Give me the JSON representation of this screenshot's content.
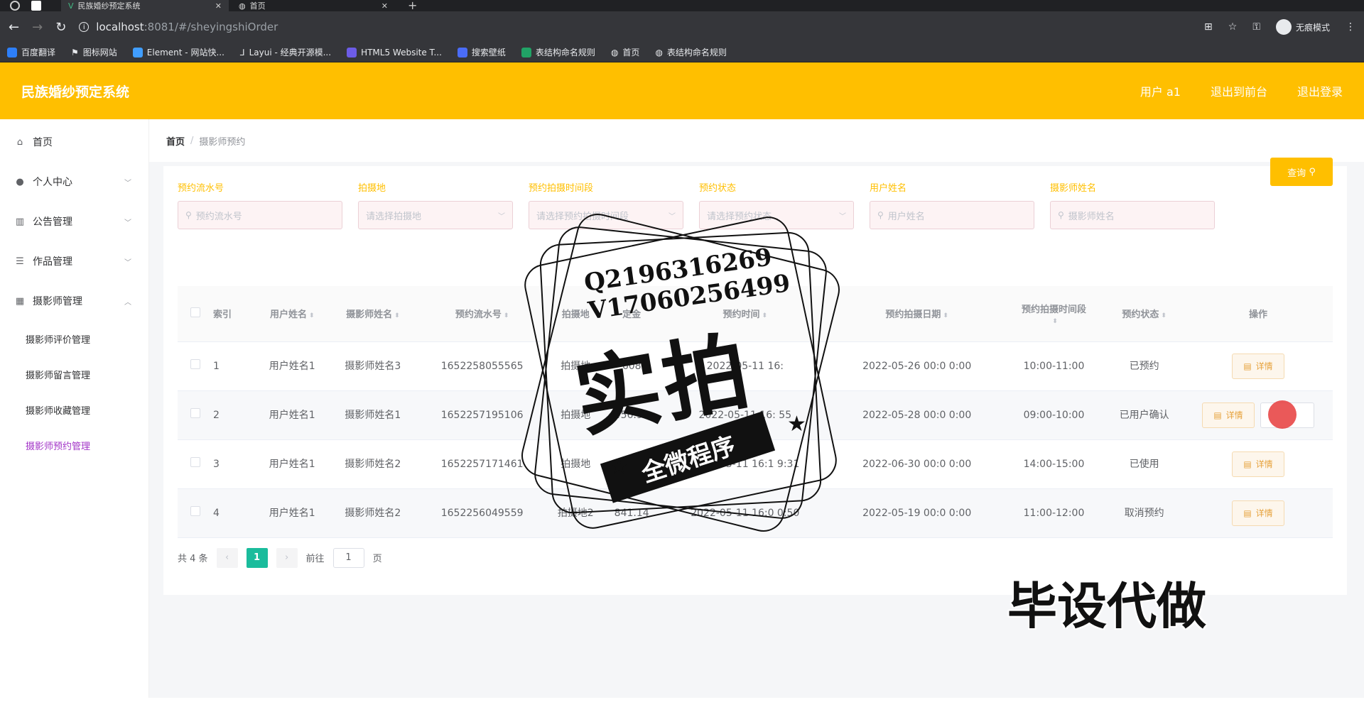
{
  "browser": {
    "tab_active": "民族婚纱预定系统",
    "tab_second": "首页",
    "url_host": "localhost",
    "url_path": ":8081/#/sheyingshiOrder",
    "profile_label": "无痕模式",
    "bookmarks": [
      "百度翻译",
      "图标网站",
      "Element - 网站快...",
      "Layui - 经典开源模...",
      "HTML5 Website T...",
      "搜索壁纸",
      "表结构命名规则",
      "首页",
      "表结构命名规则"
    ]
  },
  "header": {
    "title": "民族婚纱预定系统",
    "user_label": "用户 a1",
    "back_label": "退出到前台",
    "logout_label": "退出登录"
  },
  "sidebar": {
    "items": [
      {
        "label": "首页",
        "icon": "home-icon"
      },
      {
        "label": "个人中心",
        "icon": "user-icon"
      },
      {
        "label": "公告管理",
        "icon": "chart-icon"
      },
      {
        "label": "作品管理",
        "icon": "sliders-icon"
      },
      {
        "label": "摄影师管理",
        "icon": "grid-icon"
      }
    ],
    "sub_items": [
      "摄影师评价管理",
      "摄影师留言管理",
      "摄影师收藏管理",
      "摄影师预约管理"
    ]
  },
  "breadcrumb": {
    "home": "首页",
    "current": "摄影师预约"
  },
  "search": {
    "fields": [
      {
        "label": "预约流水号",
        "placeholder": "预约流水号"
      },
      {
        "label": "拍摄地",
        "placeholder": "请选择拍摄地"
      },
      {
        "label": "预约拍摄时间段",
        "placeholder": "请选择预约拍摄时间段"
      },
      {
        "label": "预约状态",
        "placeholder": "请选择预约状态"
      },
      {
        "label": "用户姓名",
        "placeholder": "用户姓名"
      },
      {
        "label": "摄影师姓名",
        "placeholder": "摄影师姓名"
      }
    ],
    "query_label": "查询"
  },
  "table": {
    "headers": [
      "索引",
      "用户姓名",
      "摄影师姓名",
      "预约流水号",
      "拍摄地",
      "定金",
      "预约时间",
      "预约拍摄日期",
      "预约拍摄时间段",
      "预约状态",
      "操作"
    ],
    "rows": [
      {
        "index": "1",
        "user": "用户姓名1",
        "photographer": "摄影师姓名3",
        "serial": "1652258055565",
        "place": "拍摄地",
        "deposit": "608",
        "time": "2022-05-11 16:",
        "date": "2022-05-26 00:0 0:00",
        "slot": "10:00-11:00",
        "status": "已预约"
      },
      {
        "index": "2",
        "user": "用户姓名1",
        "photographer": "摄影师姓名1",
        "serial": "1652257195106",
        "place": "拍摄地",
        "deposit": "456.94",
        "time": "2022-05-11 16: 55",
        "date": "2022-05-28 00:0 0:00",
        "slot": "09:00-10:00",
        "status": "已用户确认"
      },
      {
        "index": "3",
        "user": "用户姓名1",
        "photographer": "摄影师姓名2",
        "serial": "1652257171461",
        "place": "拍摄地",
        "deposit": "41.14",
        "time": "2022-05-11 16:1 9:31",
        "date": "2022-06-30 00:0 0:00",
        "slot": "14:00-15:00",
        "status": "已使用"
      },
      {
        "index": "4",
        "user": "用户姓名1",
        "photographer": "摄影师姓名2",
        "serial": "1652256049559",
        "place": "拍摄地2",
        "deposit": "841.14",
        "time": "2022-05-11 16:0 0:50",
        "date": "2022-05-19 00:0 0:00",
        "slot": "11:00-12:00",
        "status": "取消预约"
      }
    ],
    "detail_label": "详情"
  },
  "pagination": {
    "total": "共 4 条",
    "current": "1",
    "goto_prefix": "前往",
    "goto_value": "1",
    "goto_suffix": "页"
  },
  "watermark": {
    "qq": "Q2196316269",
    "vx": "V17060256499",
    "big": "实拍",
    "ribbon": "全微程序",
    "corner": "毕设代做"
  },
  "colors": {
    "accent": "#ffbf00",
    "active_menu": "#a234c7",
    "page_current": "#1abc9c"
  }
}
